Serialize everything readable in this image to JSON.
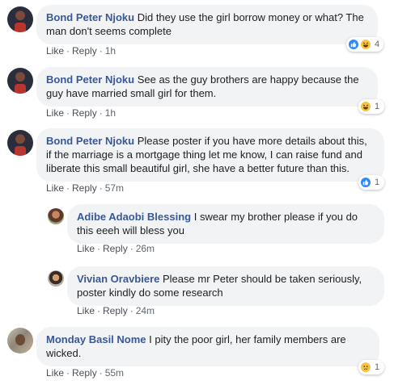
{
  "comments": [
    {
      "author": "Bond Peter Njoku",
      "text": "Did they use the girl borrow money or what? The man don't seems complete",
      "like_label": "Like",
      "reply_label": "Reply",
      "time": "1h",
      "reaction_count": "4",
      "reactions": [
        "like-icon",
        "haha-icon"
      ]
    },
    {
      "author": "Bond Peter Njoku",
      "text": "See as the guy brothers are happy because the guy have married small girl for them.",
      "like_label": "Like",
      "reply_label": "Reply",
      "time": "1h",
      "reaction_count": "1",
      "reactions": [
        "haha-icon"
      ]
    },
    {
      "author": "Bond Peter Njoku",
      "text": "Please poster if you have more details about this, if the marriage is a mortgage thing let me know, I can raise fund and liberate this small beautiful girl, she have a better future than this.",
      "like_label": "Like",
      "reply_label": "Reply",
      "time": "57m",
      "reaction_count": "1",
      "reactions": [
        "like-icon"
      ]
    },
    {
      "author": "Adibe Adaobi Blessing",
      "text": "I swear my brother please if you do this eeeh will bless you",
      "like_label": "Like",
      "reply_label": "Reply",
      "time": "26m"
    },
    {
      "author": "Vivian Oravbiere",
      "text": "Please mr Peter should be taken seriously, poster kindly do some research",
      "like_label": "Like",
      "reply_label": "Reply",
      "time": "24m"
    },
    {
      "author": "Monday Basil Nome",
      "text": "I pity the poor girl, her family members are wicked.",
      "like_label": "Like",
      "reply_label": "Reply",
      "time": "55m",
      "reaction_count": "1",
      "reactions": [
        "sad-icon"
      ]
    }
  ],
  "colors": {
    "author_name": "#385898",
    "bubble": "#f2f3f5",
    "text": "#1c1e21",
    "meta": "#606770",
    "like_reaction": "#2d88ff",
    "emoji_reaction": "#f7c53f"
  }
}
